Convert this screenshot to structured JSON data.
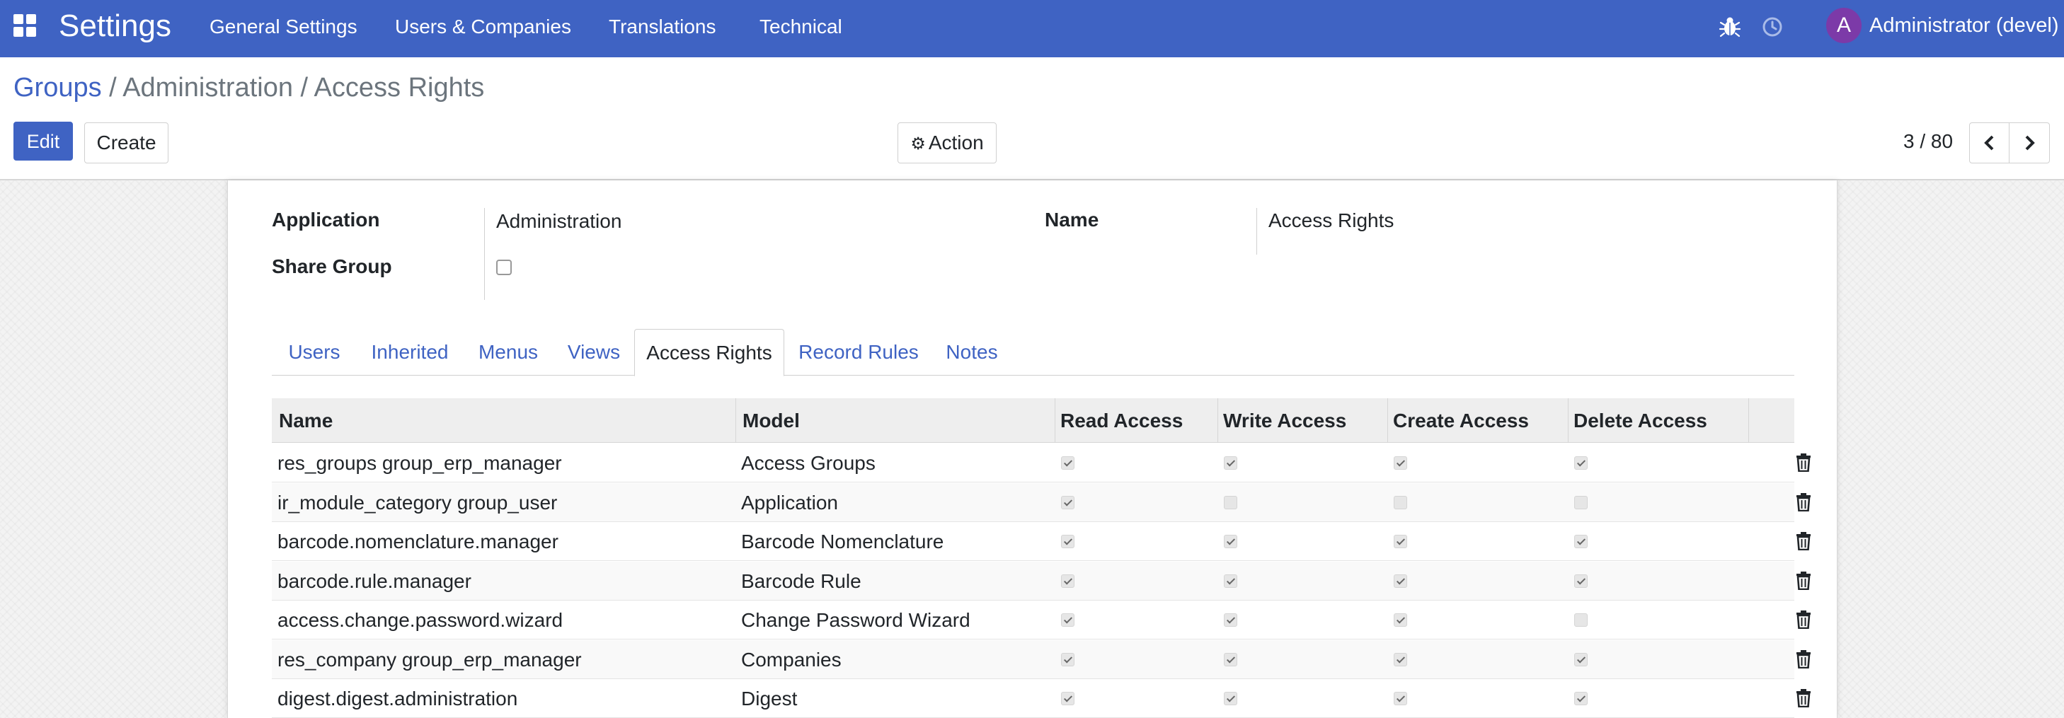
{
  "nav": {
    "brand": "Settings",
    "menu": [
      "General Settings",
      "Users & Companies",
      "Translations",
      "Technical"
    ],
    "user": {
      "initial": "A",
      "name": "Administrator (devel)"
    },
    "colors": {
      "bar": "#3f63c3",
      "avatar": "#7c3aa8"
    }
  },
  "breadcrumb": {
    "root": "Groups",
    "rest": " / Administration / Access Rights"
  },
  "buttons": {
    "edit": "Edit",
    "create": "Create",
    "action": "Action"
  },
  "pager": {
    "value": "3 / 80"
  },
  "form": {
    "application_label": "Application",
    "application_value": "Administration",
    "name_label": "Name",
    "name_value": "Access Rights",
    "share_label": "Share Group",
    "share_checked": false
  },
  "tabs": [
    {
      "label": "Users"
    },
    {
      "label": "Inherited"
    },
    {
      "label": "Menus"
    },
    {
      "label": "Views"
    },
    {
      "label": "Access Rights",
      "active": true
    },
    {
      "label": "Record Rules"
    },
    {
      "label": "Notes"
    }
  ],
  "table": {
    "columns": [
      "Name",
      "Model",
      "Read Access",
      "Write Access",
      "Create Access",
      "Delete Access"
    ],
    "rows": [
      {
        "name": "res_groups group_erp_manager",
        "model": "Access Groups",
        "read": true,
        "write": true,
        "create": true,
        "delete": true
      },
      {
        "name": "ir_module_category group_user",
        "model": "Application",
        "read": true,
        "write": false,
        "create": false,
        "delete": false
      },
      {
        "name": "barcode.nomenclature.manager",
        "model": "Barcode Nomenclature",
        "read": true,
        "write": true,
        "create": true,
        "delete": true
      },
      {
        "name": "barcode.rule.manager",
        "model": "Barcode Rule",
        "read": true,
        "write": true,
        "create": true,
        "delete": true
      },
      {
        "name": "access.change.password.wizard",
        "model": "Change Password Wizard",
        "read": true,
        "write": true,
        "create": true,
        "delete": false
      },
      {
        "name": "res_company group_erp_manager",
        "model": "Companies",
        "read": true,
        "write": true,
        "create": true,
        "delete": true
      },
      {
        "name": "digest.digest.administration",
        "model": "Digest",
        "read": true,
        "write": true,
        "create": true,
        "delete": true
      }
    ]
  }
}
